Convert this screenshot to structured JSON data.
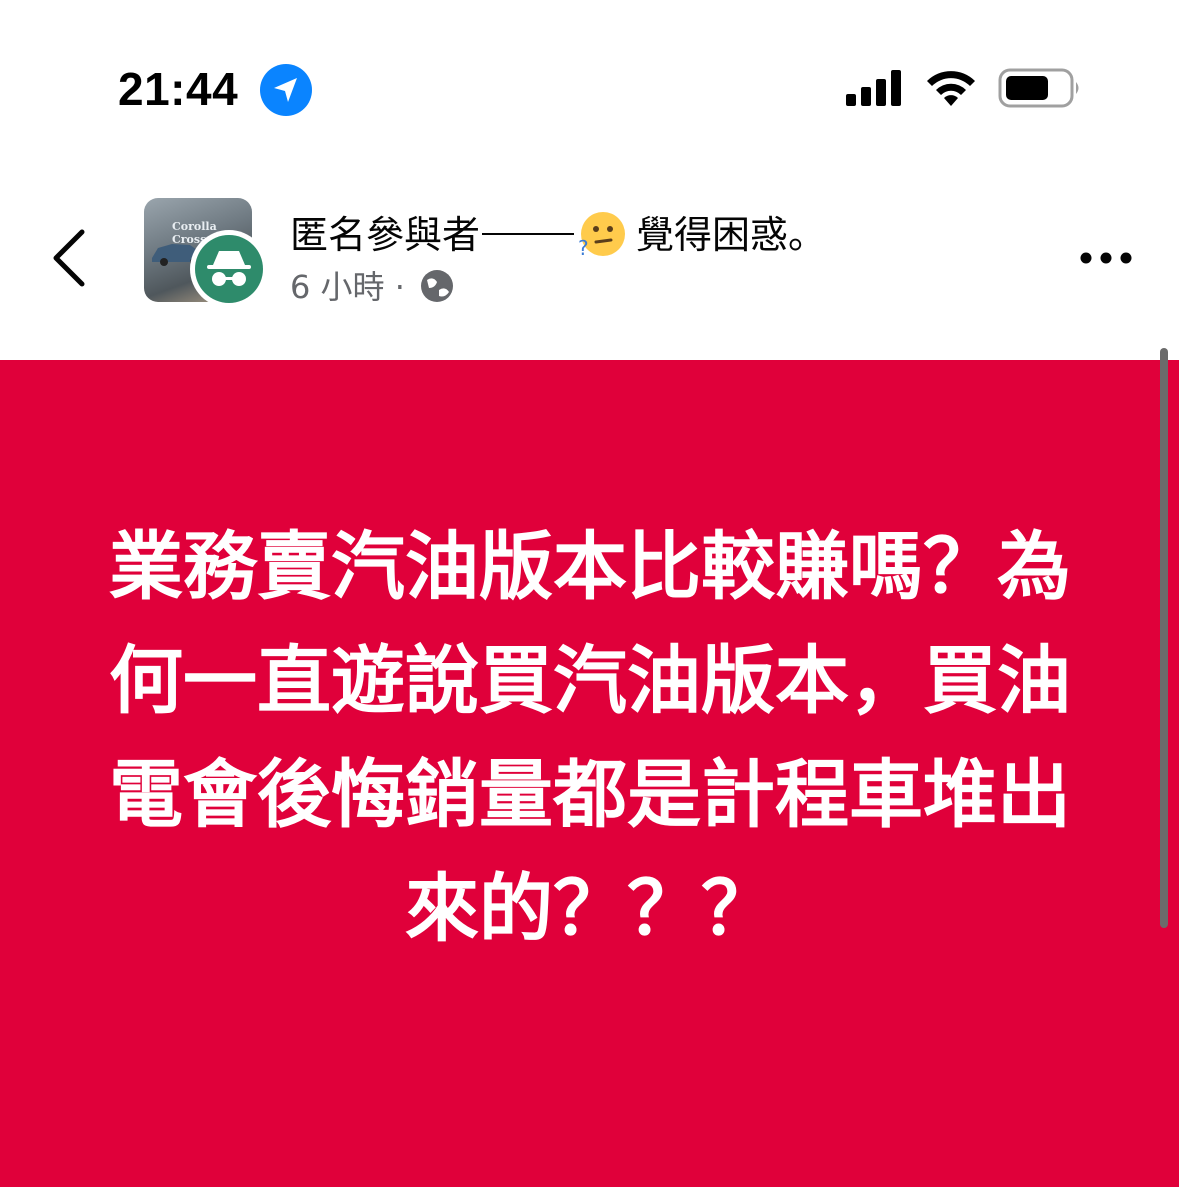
{
  "status_bar": {
    "time": "21:44",
    "icons": [
      "location-arrow-icon",
      "cellular-signal-icon",
      "wifi-icon",
      "battery-icon"
    ]
  },
  "post": {
    "author": "匿名參與者",
    "feeling_emoji": "confused-face-icon",
    "feeling_text": "覺得困惑。",
    "timestamp": "6 小時 ·",
    "privacy_icon": "globe-icon",
    "avatar_text": "Corolla Cross",
    "anon_badge_icon": "incognito-icon",
    "body_text": "業務賣汽油版本比較賺嗎？為何一直遊說買汽油版本，買油電會後悔銷量都是計程車堆出來的？？？",
    "background_color": "#e0003a"
  },
  "nav": {
    "back_icon": "chevron-left-icon",
    "more_icon": "more-dots-icon"
  }
}
